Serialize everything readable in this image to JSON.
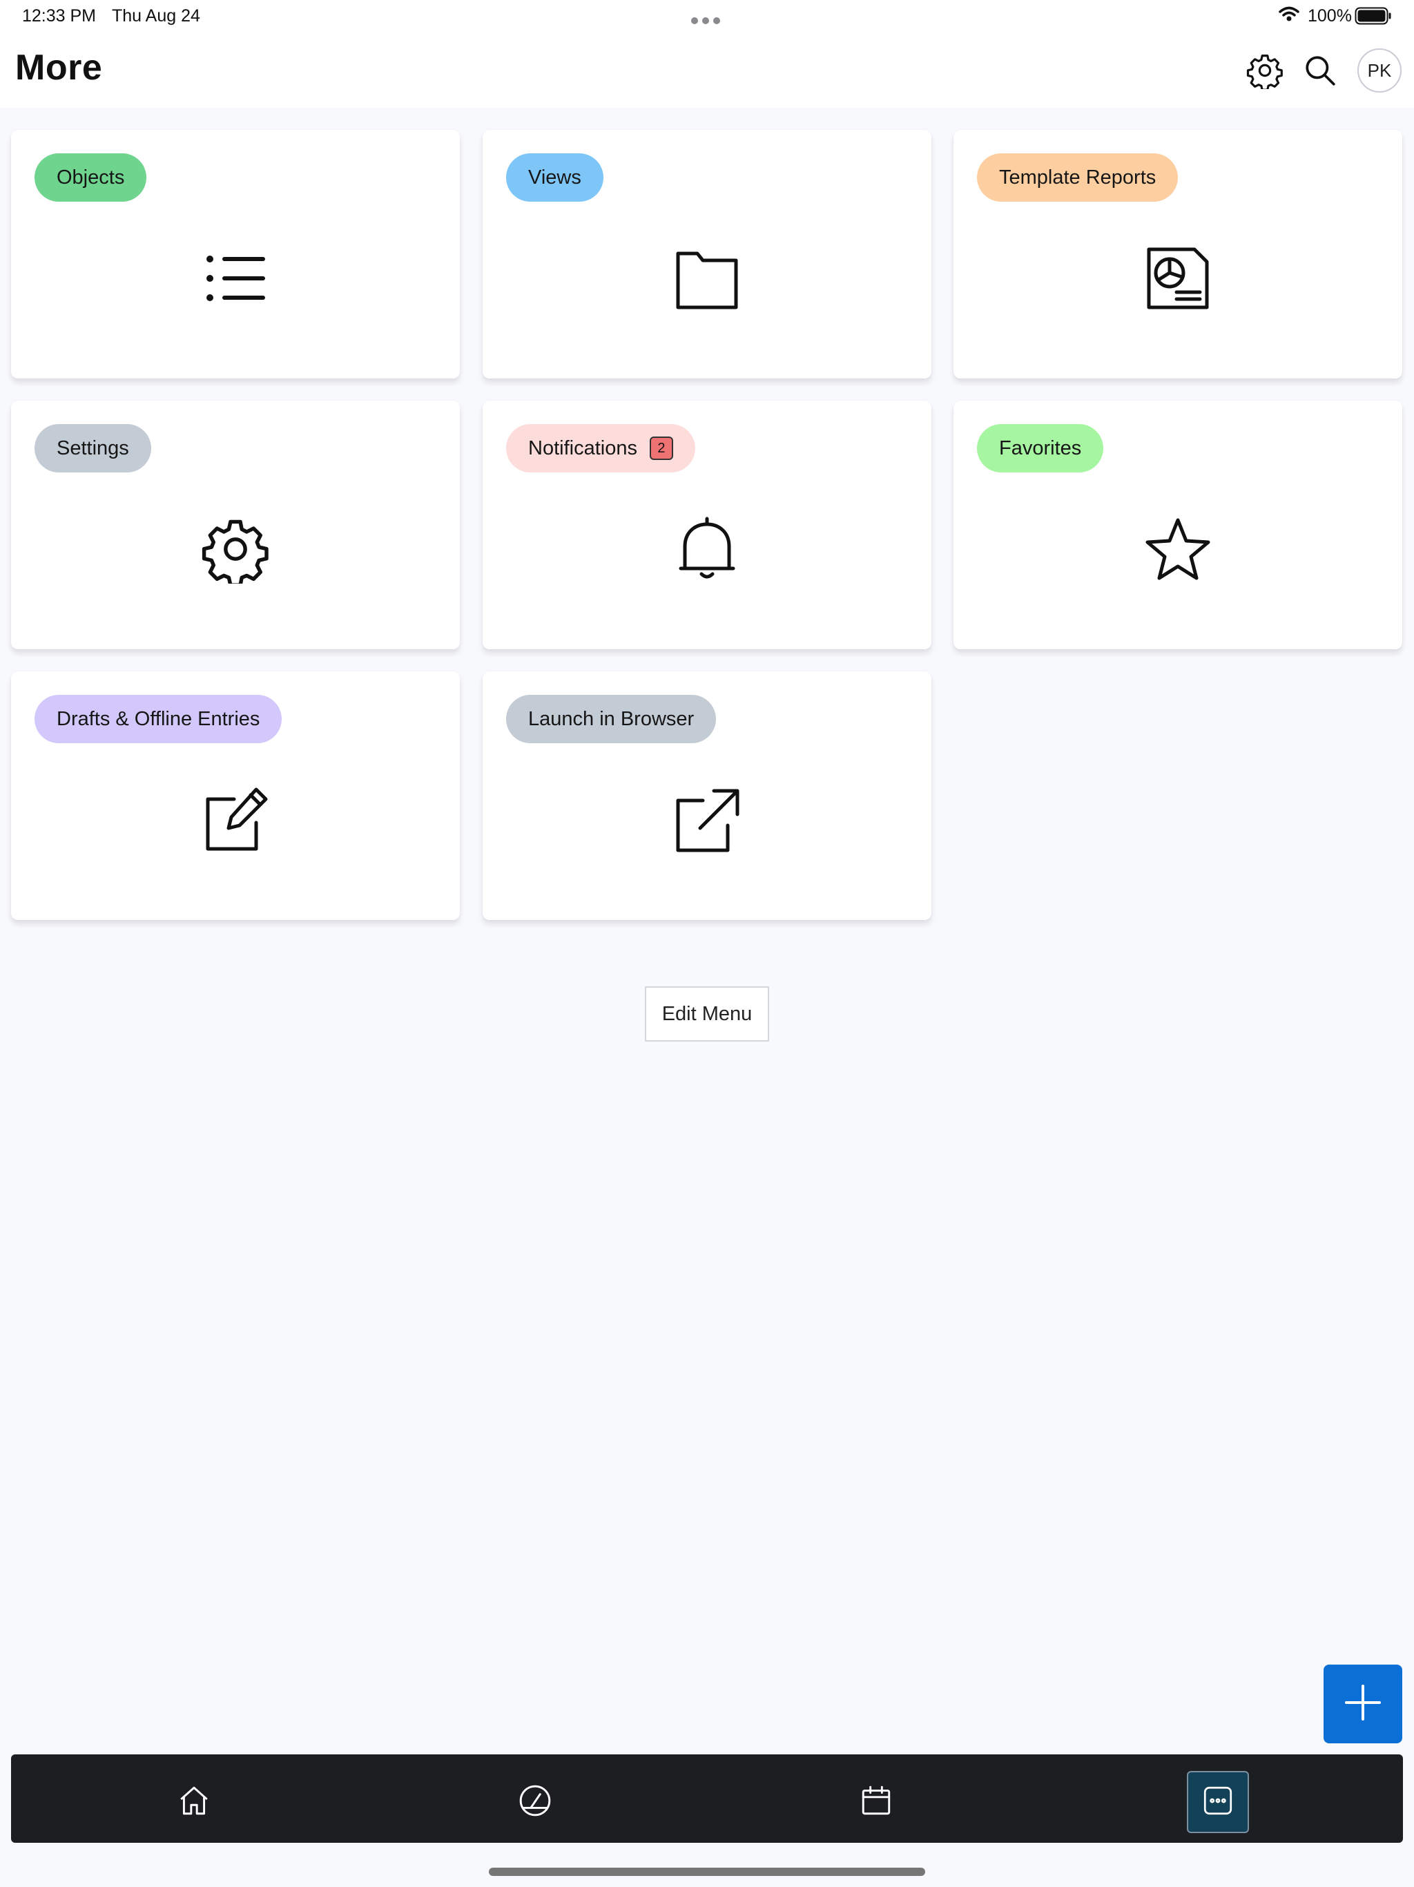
{
  "status_bar": {
    "time": "12:33 PM",
    "date": "Thu Aug 24",
    "multitask_icon": "ellipsis-icon",
    "wifi_icon": "wifi-icon",
    "battery_percent": "100%",
    "battery_icon": "battery-full-icon",
    "battery_level": 1.0
  },
  "header": {
    "title": "More",
    "settings_icon": "gear-icon",
    "search_icon": "search-icon",
    "avatar_initials": "PK"
  },
  "tiles": [
    {
      "label": "Objects",
      "pill_color": "#6fd48d",
      "icon": "list-icon"
    },
    {
      "label": "Views",
      "pill_color": "#7ec6f8",
      "icon": "folder-icon"
    },
    {
      "label": "Template Reports",
      "pill_color": "#fdcfa0",
      "icon": "report-document-icon"
    },
    {
      "label": "Settings",
      "pill_color": "#c3cbd5",
      "icon": "gear-icon"
    },
    {
      "label": "Notifications",
      "pill_color": "#fddcdc",
      "icon": "bell-icon",
      "badge": "2",
      "badge_color": "#f07373"
    },
    {
      "label": "Favorites",
      "pill_color": "#a6f5a1",
      "icon": "star-icon"
    },
    {
      "label": "Drafts & Offline Entries",
      "pill_color": "#d2c8fb",
      "icon": "edit-note-icon"
    },
    {
      "label": "Launch in Browser",
      "pill_color": "#c3cbd5",
      "icon": "external-link-icon"
    }
  ],
  "edit_menu_label": "Edit Menu",
  "fab": {
    "icon": "plus-icon",
    "color": "#0b6fd6"
  },
  "tab_bar": {
    "items": [
      {
        "icon": "home-icon",
        "active": false
      },
      {
        "icon": "dashboard-gauge-icon",
        "active": false
      },
      {
        "icon": "calendar-icon",
        "active": false
      },
      {
        "icon": "more-icon",
        "active": true
      }
    ],
    "background": "#1d1e22",
    "active_color": "#134258"
  }
}
